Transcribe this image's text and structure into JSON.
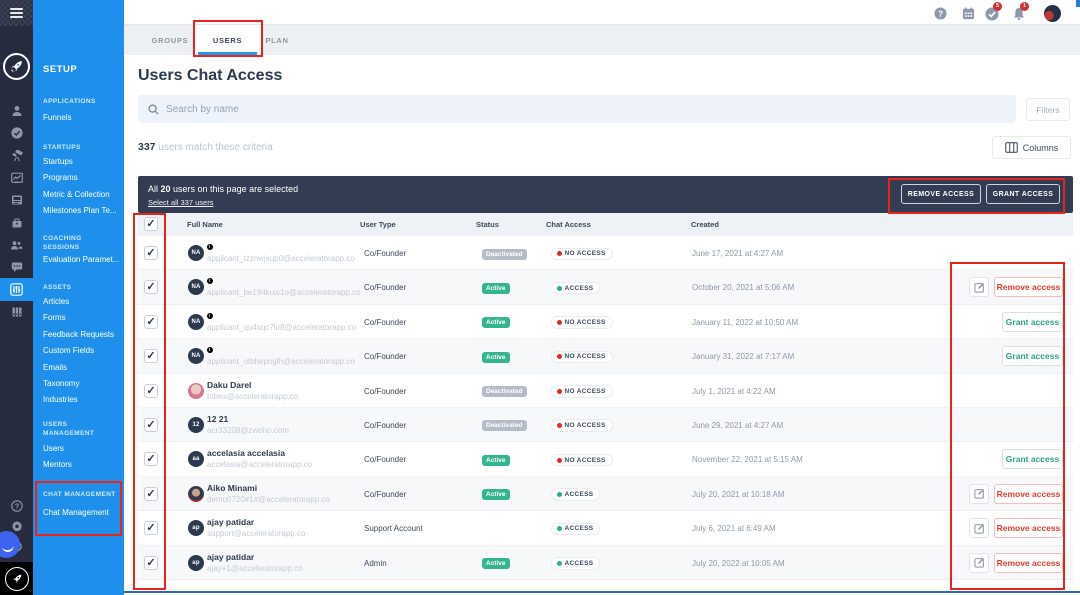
{
  "rail": {
    "menu_icon": "hamburger-icon",
    "logo": "rocket-logo",
    "items": [
      {
        "icon": "person",
        "active": false
      },
      {
        "icon": "check",
        "active": false
      },
      {
        "icon": "telescope",
        "active": false
      },
      {
        "icon": "chart",
        "active": false
      },
      {
        "icon": "news",
        "active": false
      },
      {
        "icon": "org",
        "active": false
      },
      {
        "icon": "people",
        "active": false
      },
      {
        "icon": "chat",
        "active": false
      },
      {
        "icon": "sliders",
        "active": true
      },
      {
        "icon": "books",
        "active": false
      }
    ],
    "bottom_items": [
      {
        "icon": "help"
      },
      {
        "icon": "gear"
      },
      {
        "icon": "power"
      }
    ]
  },
  "sidebar": {
    "title": "SETUP",
    "sections": [
      {
        "header": "APPLICATIONS",
        "items": [
          "Funnels"
        ]
      },
      {
        "header": "STARTUPS",
        "items": [
          "Startups",
          "Programs",
          "Metric & Collection",
          "Milestones Plan Te..."
        ]
      },
      {
        "header": "COACHING SESSIONS",
        "items": [
          "Evaluation Paramet..."
        ]
      },
      {
        "header": "ASSETS",
        "items": [
          "Articles",
          "Forms",
          "Feedback Requests",
          "Custom Fields",
          "Emails",
          "Taxonomy",
          "Industries"
        ]
      },
      {
        "header": "USERS MANAGEMENT",
        "items": [
          "Users",
          "Mentors"
        ]
      },
      {
        "header": "CHAT MANAGEMENT",
        "items": [
          "Chat Management"
        ]
      }
    ]
  },
  "topbar": {
    "icons": [
      "help-icon",
      "calendar-icon",
      "tasks-icon",
      "bell-icon"
    ],
    "tasks_badge": "5",
    "bell_badge": "1"
  },
  "tabs": [
    {
      "label": "GROUPS",
      "active": false
    },
    {
      "label": "USERS",
      "active": true
    },
    {
      "label": "PLAN",
      "active": false
    }
  ],
  "page": {
    "title": "Users Chat Access",
    "search_placeholder": "Search by name",
    "filters_label": "Filters",
    "match_count": "337",
    "match_text": " users match these criteria",
    "columns_label": "Columns"
  },
  "selection": {
    "line1_pre": "All ",
    "count": "20",
    "line1_post": " users on this page are selected",
    "select_all": "Select all 337 users",
    "remove_label": "REMOVE ACCESS",
    "grant_label": "GRANT ACCESS"
  },
  "table": {
    "headers": [
      "Full Name",
      "User Type",
      "Status",
      "Chat Access",
      "Created"
    ],
    "rows": [
      {
        "name": "",
        "flag": true,
        "avatar": "NA",
        "avatar_type": "initials",
        "email": "applicant_tzznwjxup0@acceleratorapp.co",
        "user_type": "Co/Founder",
        "status": "Deactivated",
        "access": "NO ACCESS",
        "access_state": "no",
        "created": "June 17, 2021 at 4:27 AM",
        "actions": []
      },
      {
        "name": "",
        "flag": true,
        "avatar": "NA",
        "avatar_type": "initials",
        "email": "applicant_be194kuw1o@acceleratorapp.co",
        "user_type": "Co/Founder",
        "status": "Active",
        "access": "ACCESS",
        "access_state": "yes",
        "created": "October 20, 2021 at 5:06 AM",
        "actions": [
          "edit",
          "remove"
        ]
      },
      {
        "name": "",
        "flag": true,
        "avatar": "NA",
        "avatar_type": "initials",
        "email": "applicant_qu4xqc7lu8@acceleratorapp.co",
        "user_type": "Co/Founder",
        "status": "Active",
        "access": "NO ACCESS",
        "access_state": "no",
        "created": "January 11, 2022 at 10:50 AM",
        "actions": [
          "grant"
        ]
      },
      {
        "name": "",
        "flag": true,
        "avatar": "NA",
        "avatar_type": "initials",
        "email": "applicant_otbhepoglh@acceleratorapp.co",
        "user_type": "Co/Founder",
        "status": "Active",
        "access": "NO ACCESS",
        "access_state": "no",
        "created": "January 31, 2022 at 7:17 AM",
        "actions": [
          "grant"
        ]
      },
      {
        "name": "Daku Darel",
        "flag": false,
        "avatar": "",
        "avatar_type": "photo-pink",
        "email": "tribex@acceleratorapp.co",
        "user_type": "Co/Founder",
        "status": "Deactivated",
        "access": "NO ACCESS",
        "access_state": "no",
        "created": "July 1, 2021 at 4:22 AM",
        "actions": []
      },
      {
        "name": "12 21",
        "flag": false,
        "avatar": "12",
        "avatar_type": "initials",
        "email": "acr33208@zwoho.com",
        "user_type": "Co/Founder",
        "status": "Deactivated",
        "access": "NO ACCESS",
        "access_state": "no",
        "created": "June 29, 2021 at 4:27 AM",
        "actions": []
      },
      {
        "name": "accelasia accelasia",
        "flag": false,
        "avatar": "aa",
        "avatar_type": "initials",
        "email": "accelasia@acceleratorapp.co",
        "user_type": "Co/Founder",
        "status": "Active",
        "access": "NO ACCESS",
        "access_state": "no",
        "created": "November 22, 2021 at 5:15 AM",
        "actions": [
          "grant"
        ]
      },
      {
        "name": "Aiko Minami",
        "flag": false,
        "avatar": "",
        "avatar_type": "photo-dark",
        "email": "demo0720#1#@acceleratorapp.co",
        "user_type": "Co/Founder",
        "status": "Active",
        "access": "ACCESS",
        "access_state": "yes",
        "created": "July 20, 2021 at 10:18 AM",
        "actions": [
          "edit",
          "remove"
        ]
      },
      {
        "name": "ajay patidar",
        "flag": false,
        "avatar": "ap",
        "avatar_type": "initials",
        "email": "support@acceleratorapp.co",
        "user_type": "Support Account",
        "status": "",
        "access": "ACCESS",
        "access_state": "yes",
        "created": "July 6, 2021 at 6:49 AM",
        "actions": [
          "edit",
          "remove"
        ]
      },
      {
        "name": "ajay patidar",
        "flag": false,
        "avatar": "ap",
        "avatar_type": "initials",
        "email": "ajay+1@acceleratorapp.co",
        "user_type": "Admin",
        "status": "Active",
        "access": "ACCESS",
        "access_state": "yes",
        "created": "July 20, 2022 at 10:05 AM",
        "actions": [
          "edit",
          "remove"
        ]
      }
    ],
    "row_actions": {
      "remove_label": "Remove access",
      "grant_label": "Grant access"
    }
  }
}
